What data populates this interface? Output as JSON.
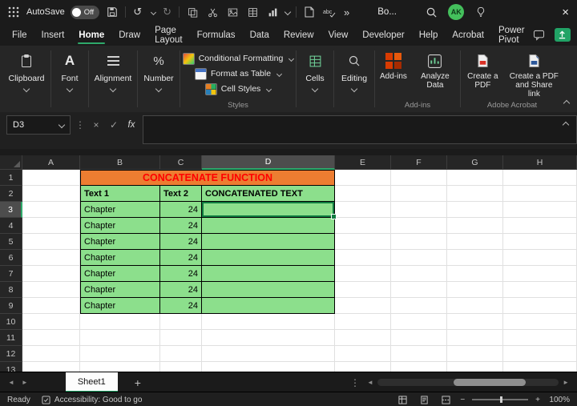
{
  "titlebar": {
    "autosave_label": "AutoSave",
    "autosave_state": "Off",
    "doc_title": "Bo...",
    "avatar_initials": "AK"
  },
  "icons": {
    "undo": "↺",
    "redo": "↻",
    "more": "»",
    "close": "×",
    "cancel": "×",
    "enter": "✓",
    "fx": "fx",
    "dots": "⋮",
    "font": "A",
    "percent": "%",
    "minus": "−",
    "plus": "+",
    "add_sheet": "+",
    "tab_prev": "◄",
    "tab_next": "►"
  },
  "menubar": {
    "tabs": [
      "File",
      "Insert",
      "Home",
      "Draw",
      "Page Layout",
      "Formulas",
      "Data",
      "Review",
      "View",
      "Developer",
      "Help",
      "Acrobat",
      "Power Pivot"
    ],
    "active_tab": "Home"
  },
  "ribbon": {
    "clipboard_label": "Clipboard",
    "font_label": "Font",
    "alignment_label": "Alignment",
    "number_label": "Number",
    "styles_items": [
      "Conditional Formatting",
      "Format as Table",
      "Cell Styles"
    ],
    "styles_label": "Styles",
    "cells_label": "Cells",
    "editing_label": "Editing",
    "addins_label": "Add-ins",
    "addins_group_label": "Add-ins",
    "analyze_label": "Analyze Data",
    "pdf_label": "Create a PDF",
    "pdf_share_label": "Create a PDF and Share link",
    "acrobat_group_label": "Adobe Acrobat"
  },
  "formula_bar": {
    "name_box": "D3",
    "formula": ""
  },
  "sheet": {
    "col_labels": [
      "A",
      "B",
      "C",
      "D",
      "E",
      "F",
      "G",
      "H"
    ],
    "row_count": 13,
    "selected": {
      "col": "D",
      "row": 3
    },
    "table": {
      "title": "CONCATENATE FUNCTION",
      "headers": [
        "Text 1",
        "Text 2",
        "CONCATENATED TEXT"
      ],
      "rows": [
        [
          "Chapter",
          "24",
          ""
        ],
        [
          "Chapter",
          "24",
          ""
        ],
        [
          "Chapter",
          "24",
          ""
        ],
        [
          "Chapter",
          "24",
          ""
        ],
        [
          "Chapter",
          "24",
          ""
        ],
        [
          "Chapter",
          "24",
          ""
        ],
        [
          "Chapter",
          "24",
          ""
        ]
      ]
    },
    "colors": {
      "title_bg": "#ED7D31",
      "title_text": "#FF0000",
      "table_bg": "#8CDF8C",
      "selection": "#107C41"
    }
  },
  "tabs_bar": {
    "sheet_name": "Sheet1"
  },
  "status_bar": {
    "ready": "Ready",
    "accessibility": "Accessibility: Good to go",
    "zoom": "100%"
  }
}
